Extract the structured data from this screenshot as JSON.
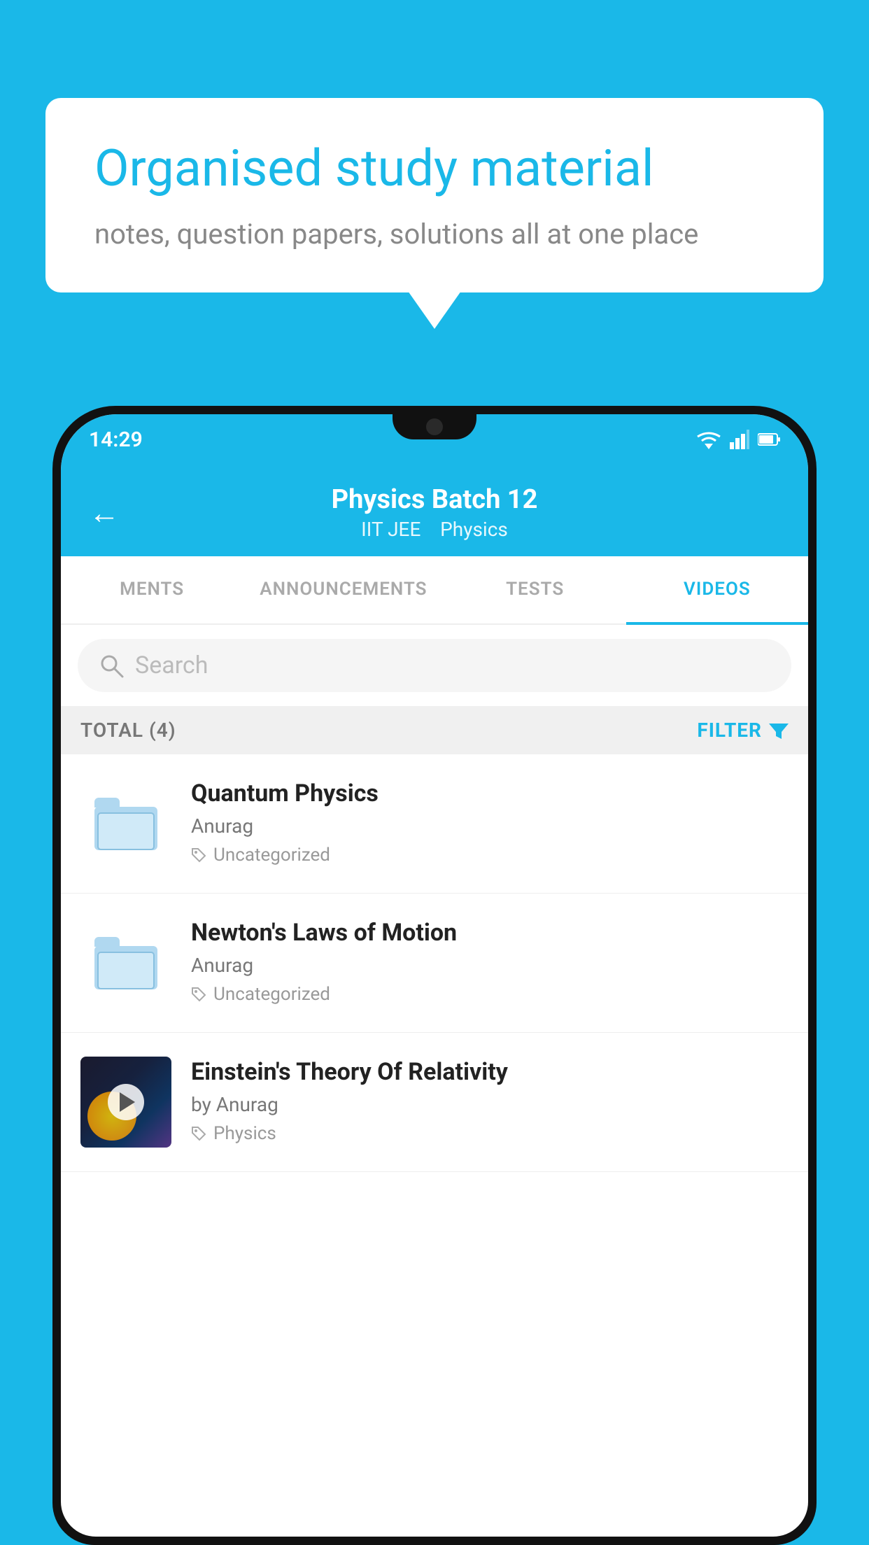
{
  "background_color": "#1ab8e8",
  "speech_bubble": {
    "heading": "Organised study material",
    "subtext": "notes, question papers, solutions all at one place"
  },
  "status_bar": {
    "time": "14:29",
    "signal_icon": "signal",
    "battery_icon": "battery"
  },
  "app_header": {
    "back_label": "←",
    "title": "Physics Batch 12",
    "subtitle_tag1": "IIT JEE",
    "subtitle_tag2": "Physics"
  },
  "tabs": [
    {
      "label": "MENTS",
      "active": false
    },
    {
      "label": "ANNOUNCEMENTS",
      "active": false
    },
    {
      "label": "TESTS",
      "active": false
    },
    {
      "label": "VIDEOS",
      "active": true
    }
  ],
  "search": {
    "placeholder": "Search"
  },
  "filter_bar": {
    "total_label": "TOTAL (4)",
    "filter_label": "FILTER"
  },
  "videos": [
    {
      "title": "Quantum Physics",
      "author": "Anurag",
      "tag": "Uncategorized",
      "type": "folder",
      "has_thumbnail": false
    },
    {
      "title": "Newton's Laws of Motion",
      "author": "Anurag",
      "tag": "Uncategorized",
      "type": "folder",
      "has_thumbnail": false
    },
    {
      "title": "Einstein's Theory Of Relativity",
      "author": "by Anurag",
      "tag": "Physics",
      "type": "video",
      "has_thumbnail": true
    }
  ]
}
